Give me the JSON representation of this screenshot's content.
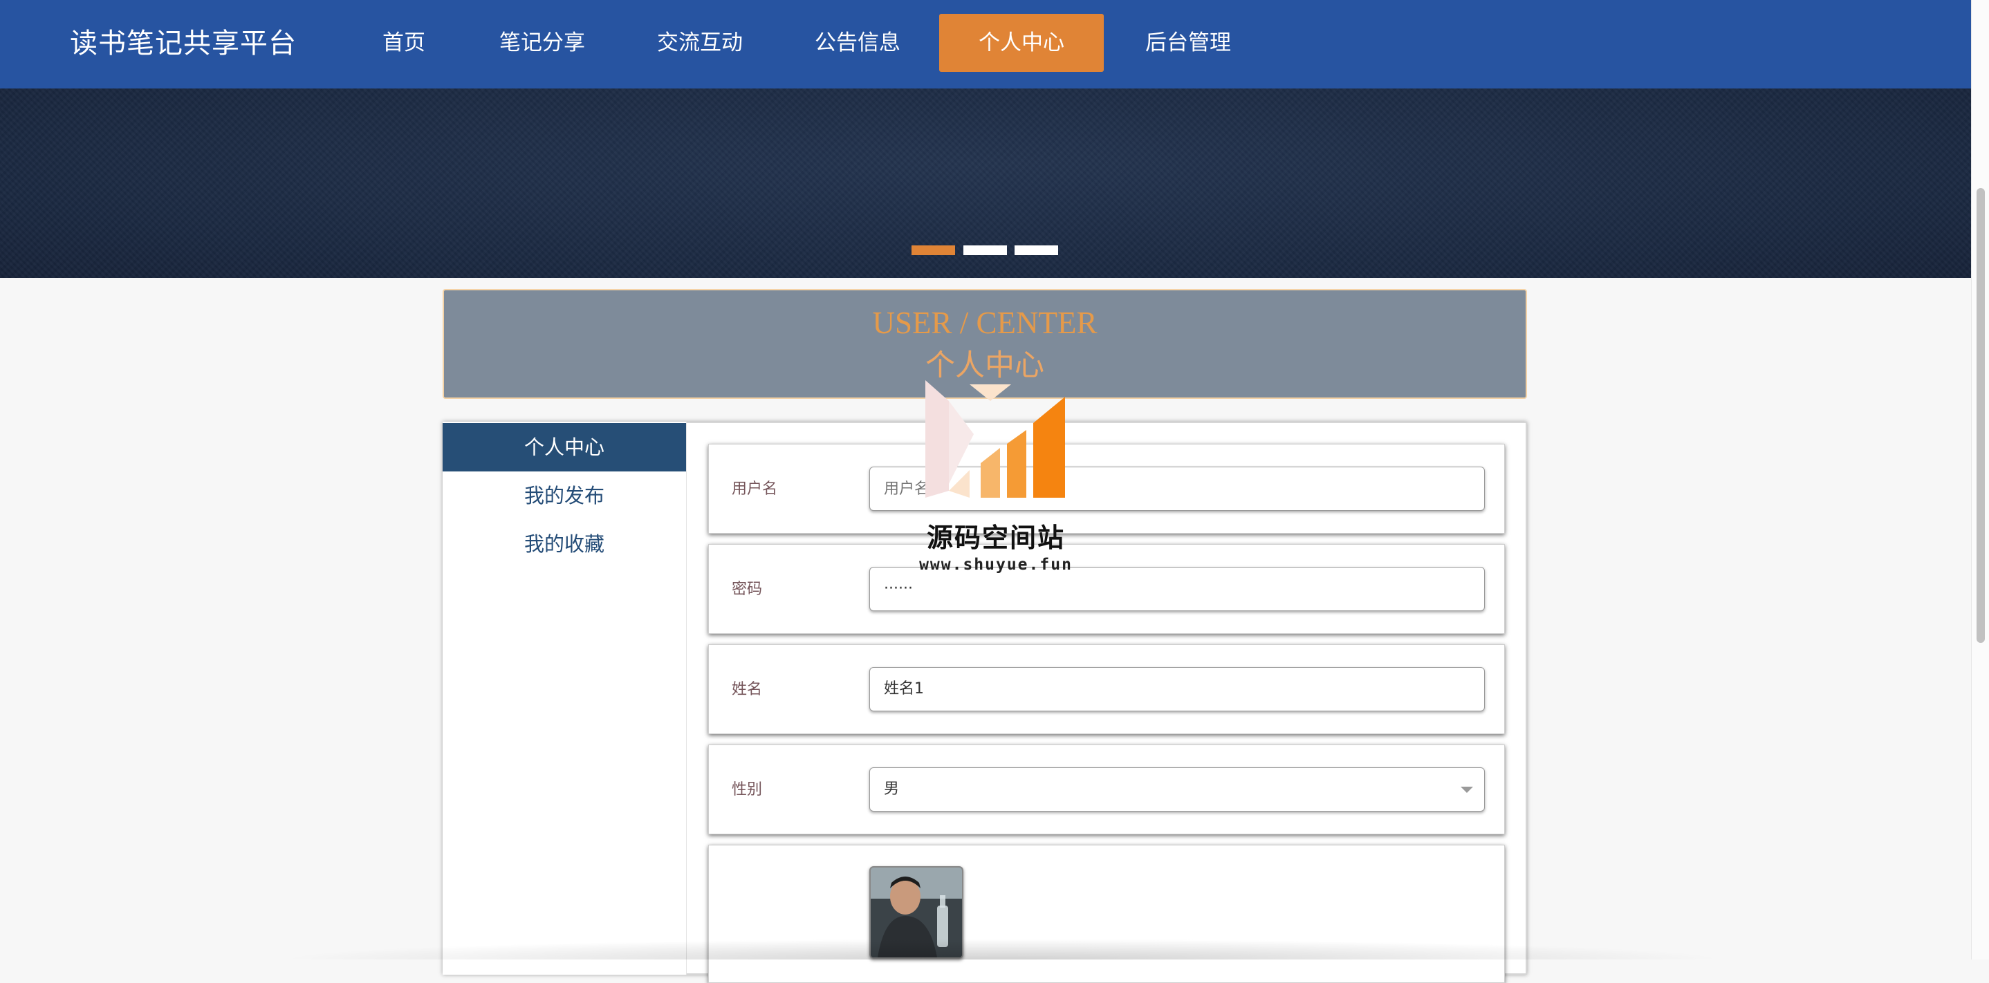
{
  "nav": {
    "brand": "读书笔记共享平台",
    "items": [
      "首页",
      "笔记分享",
      "交流互动",
      "公告信息",
      "个人中心",
      "后台管理"
    ],
    "active_index": 4
  },
  "banner": {
    "active_slide": 1,
    "slide_count": 3
  },
  "section": {
    "title_en": "USER / CENTER",
    "title_cn": "个人中心"
  },
  "sidebar": {
    "items": [
      "个人中心",
      "我的发布",
      "我的收藏"
    ],
    "active_index": 0
  },
  "form": {
    "username": {
      "label": "用户名",
      "placeholder": "用户名",
      "value": ""
    },
    "password": {
      "label": "密码",
      "value": "······"
    },
    "name": {
      "label": "姓名",
      "value": "姓名1"
    },
    "gender": {
      "label": "性别",
      "value": "男"
    }
  },
  "watermark": {
    "text": "源码空间站",
    "url": "www.shuyue.fun"
  },
  "colors": {
    "nav_bg": "#2754a1",
    "accent": "#e08436",
    "sidebar_active": "#264e76",
    "title_bg": "#7e8b9a"
  }
}
